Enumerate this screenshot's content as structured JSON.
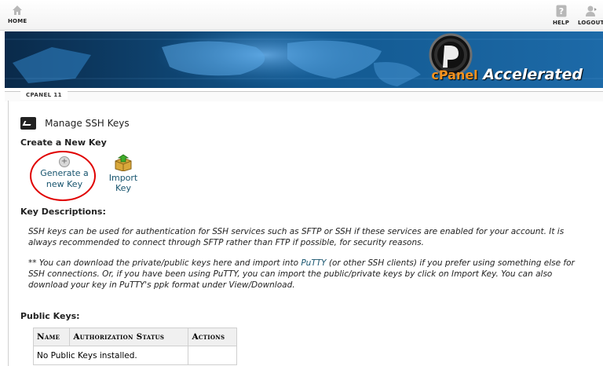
{
  "topnav": {
    "home_label": "HOME",
    "help_label": "HELP",
    "logout_label": "LOGOUT"
  },
  "banner": {
    "brand_prefix": "cPanel",
    "brand_suffix": "Accelerated"
  },
  "version_label": "CPANEL 11",
  "page": {
    "title": "Manage SSH Keys",
    "create_heading": "Create a New Key",
    "generate_line1": "Generate a",
    "generate_line2": "new Key",
    "import_line1": "Import",
    "import_line2": "Key",
    "descriptions_heading": "Key Descriptions:",
    "desc_para1": "SSH keys can be used for authentication for SSH services such as SFTP or SSH if these services are enabled for your account. It is always recommended to connect through SFTP rather than FTP if possible, for security reasons.",
    "desc_para2_before": "** You can download the private/public keys here and import into ",
    "desc_para2_link": "PuTTY",
    "desc_para2_after": " (or other SSH clients) if you prefer using something else for SSH connections. Or, if you have been using PuTTY, you can import the public/private keys by click on Import Key. You can also download your key in PuTTY's ppk format under View/Download.",
    "public_keys_heading": "Public Keys:"
  },
  "keys_table": {
    "headers": [
      "Name",
      "Authorization Status",
      "Actions"
    ],
    "empty_message": "No Public Keys installed."
  },
  "colors": {
    "link": "#17546e",
    "highlight_ring": "#e00000",
    "banner_bg": "#0b3b66"
  }
}
